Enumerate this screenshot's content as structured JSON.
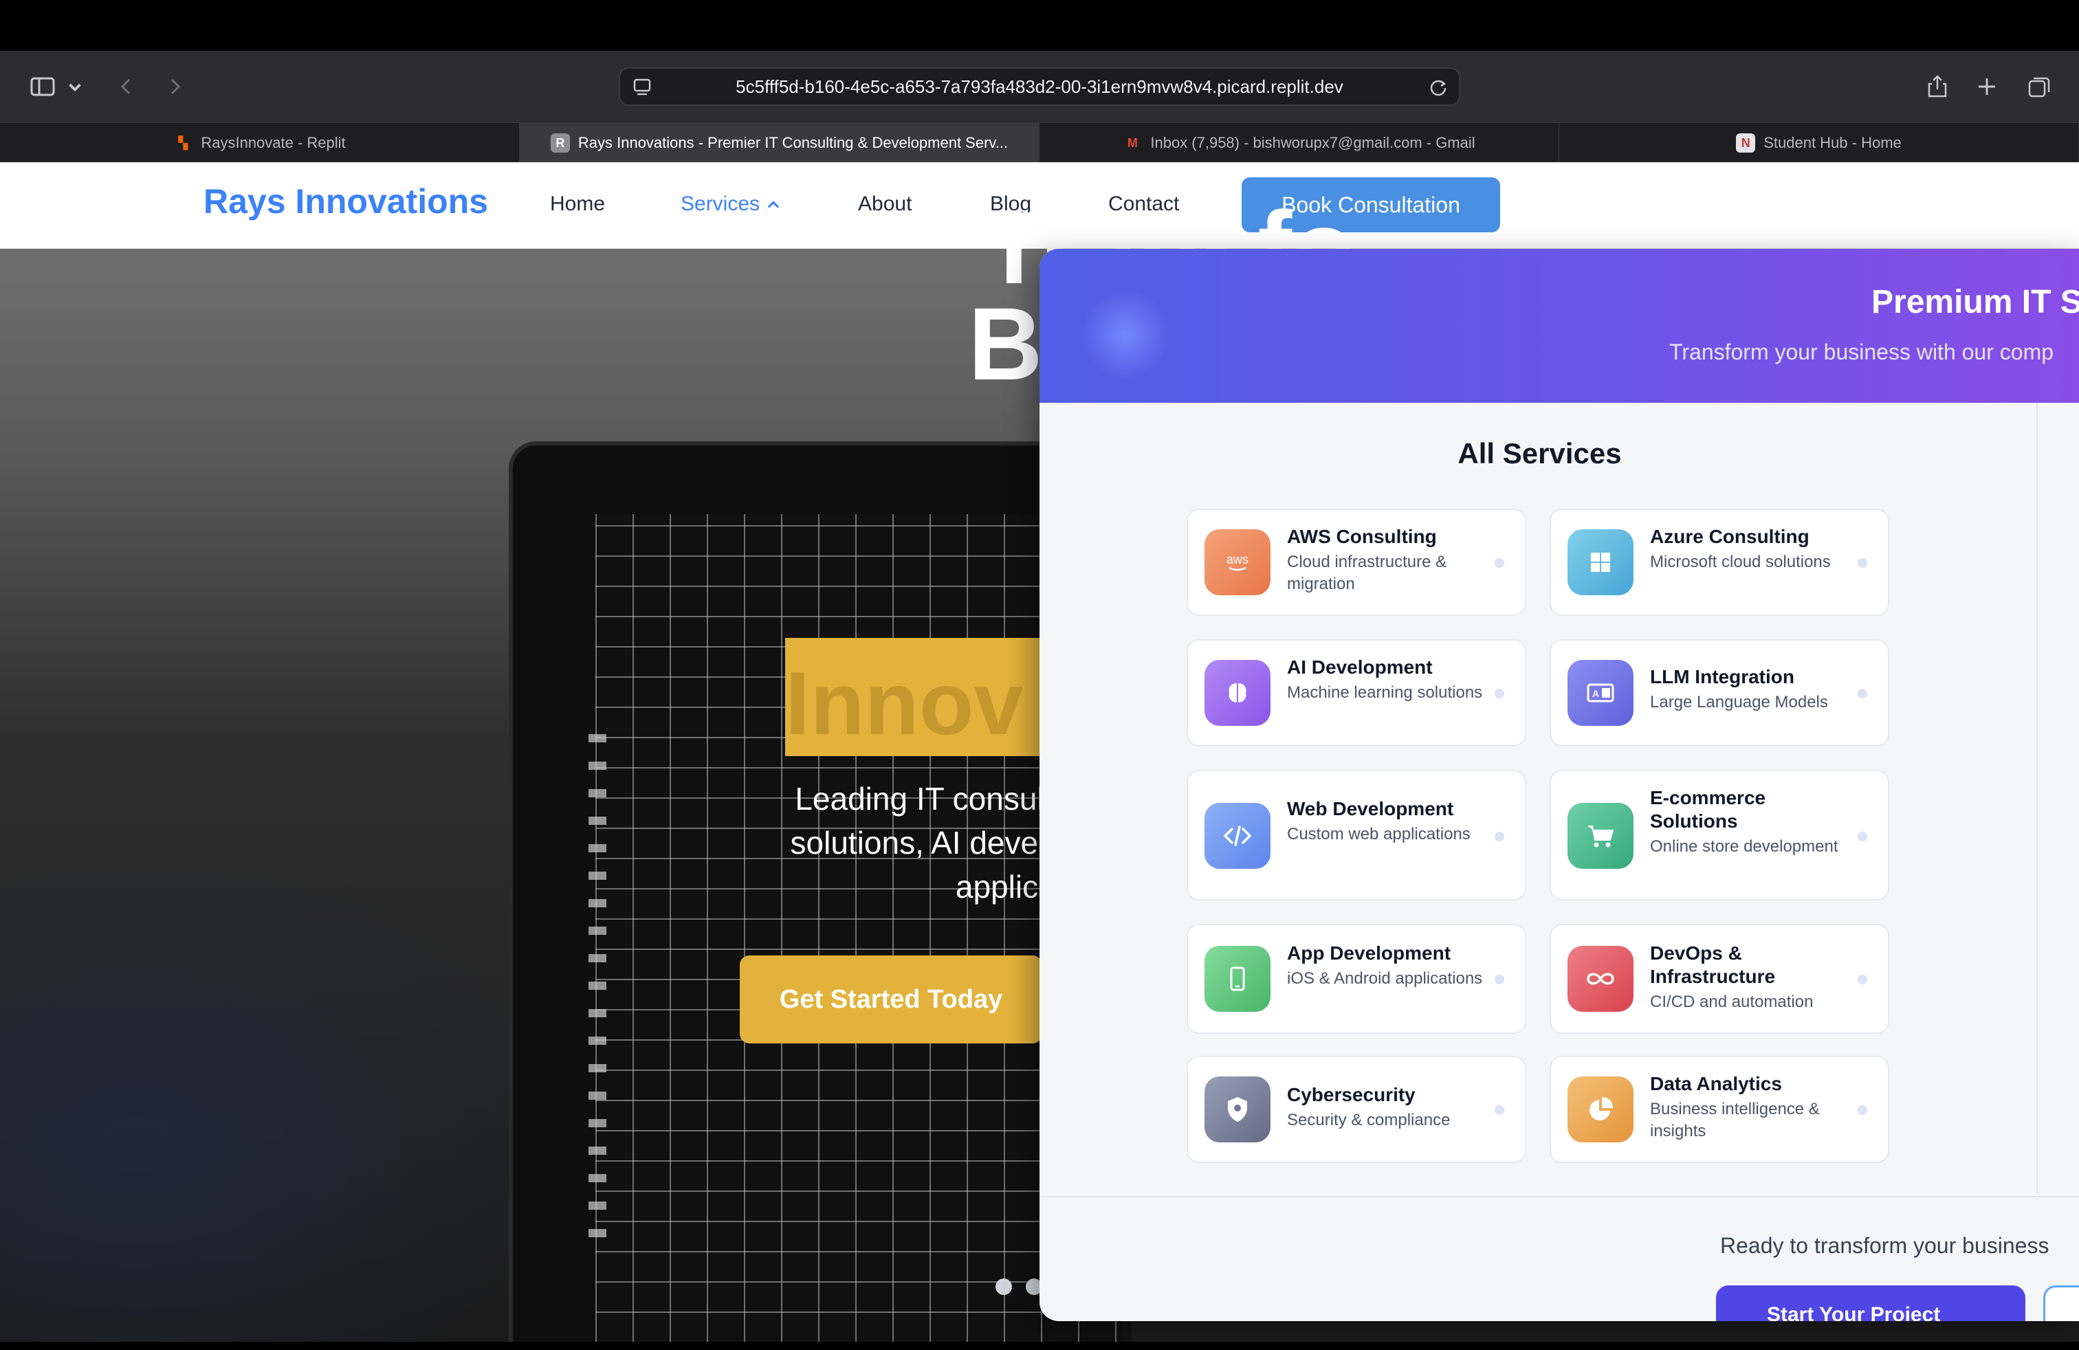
{
  "browser": {
    "url": "5c5fff5d-b160-4e5c-a653-7a793fa483d2-00-3i1ern9mvw8v4.picard.replit.dev",
    "tabs": [
      {
        "label": "RaysInnovate - Replit",
        "favicon": "replit-icon"
      },
      {
        "label": "Rays Innovations - Premier IT Consulting & Development Serv...",
        "favicon": "r-letter-icon"
      },
      {
        "label": "Inbox (7,958) - bishworupx7@gmail.com - Gmail",
        "favicon": "gmail-icon"
      },
      {
        "label": "Student Hub - Home",
        "favicon": "student-hub-icon"
      }
    ]
  },
  "nav": {
    "logo": "Rays Innovations",
    "links": [
      "Home",
      "Services",
      "About",
      "Blog",
      "Contact"
    ],
    "cta": "Book Consultation"
  },
  "hero": {
    "title_line1": "Transfo",
    "title_line2": "Busines",
    "highlight": "Innov",
    "subtitle_line1": "Leading IT consulting compa",
    "subtitle_line2": "solutions, AI development, an",
    "subtitle_line3": "applic",
    "button": "Get Started Today"
  },
  "panel": {
    "title": "Premium IT S",
    "subtitle": "Transform your business with our comp",
    "section_title": "All Services",
    "services": [
      {
        "title": "AWS Consulting",
        "desc": "Cloud infrastructure & migration",
        "icon": "aws-icon",
        "color": "#f08a5d"
      },
      {
        "title": "Azure Consulting",
        "desc": "Microsoft cloud solutions",
        "icon": "windows-icon",
        "color": "#5fb6e0"
      },
      {
        "title": "AI Development",
        "desc": "Machine learning solutions",
        "icon": "brain-icon",
        "color": "#9b6cf0"
      },
      {
        "title": "LLM Integration",
        "desc": "Large Language Models",
        "icon": "language-icon",
        "color": "#6b72e8"
      },
      {
        "title": "Web Development",
        "desc": "Custom web applications",
        "icon": "code-icon",
        "color": "#6a94f0"
      },
      {
        "title": "E-commerce Solutions",
        "desc": "Online store development",
        "icon": "cart-icon",
        "color": "#3fb58a"
      },
      {
        "title": "App Development",
        "desc": "iOS & Android applications",
        "icon": "phone-icon",
        "color": "#5cc47a"
      },
      {
        "title": "DevOps & Infrastructure",
        "desc": "CI/CD and automation",
        "icon": "infinity-icon",
        "color": "#e0525a"
      },
      {
        "title": "Cybersecurity",
        "desc": "Security & compliance",
        "icon": "shield-icon",
        "color": "#6f7893"
      },
      {
        "title": "Data Analytics",
        "desc": "Business intelligence & insights",
        "icon": "pie-chart-icon",
        "color": "#eaa24a"
      }
    ],
    "footer_text": "Ready to transform your business",
    "footer_button": "Start Your Project"
  }
}
